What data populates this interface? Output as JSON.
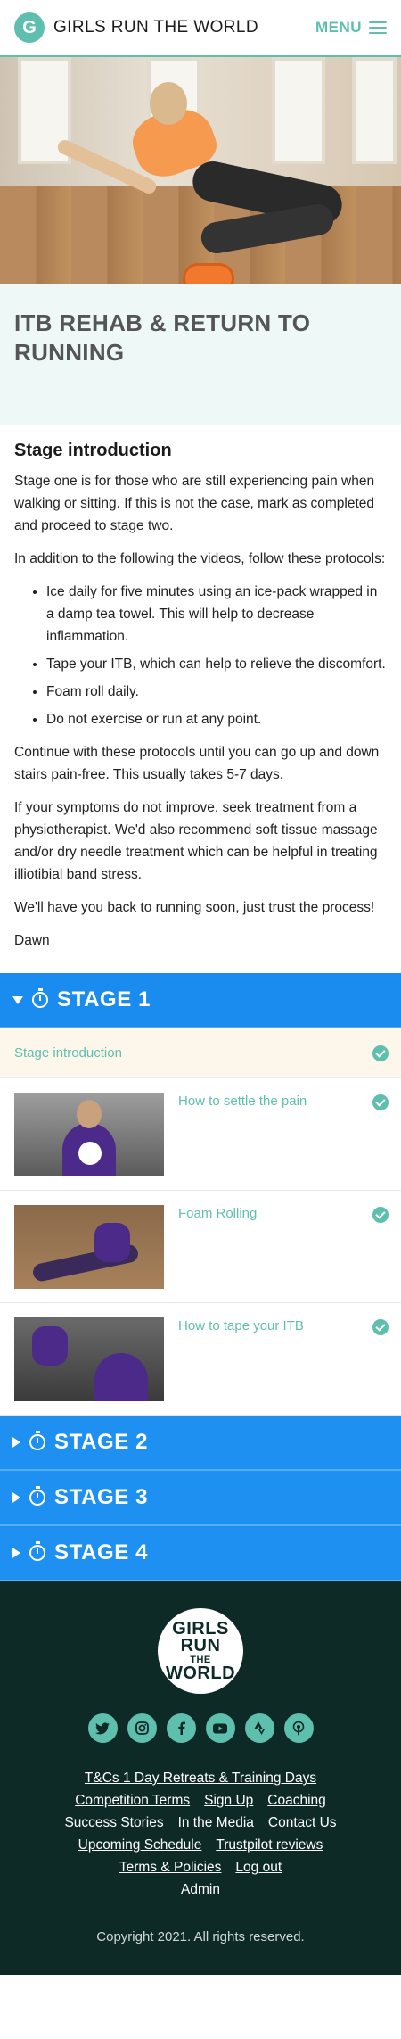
{
  "header": {
    "logo_letter": "G",
    "brand": "GIRLS RUN THE WORLD",
    "menu_label": "MENU"
  },
  "page": {
    "title": "ITB REHAB & RETURN TO RUNNING"
  },
  "intro": {
    "heading": "Stage introduction",
    "p1": "Stage one is for those who are still experiencing pain when walking or sitting. If this is not the case, mark as completed and proceed to stage two.",
    "p2": "In addition to the following the videos, follow these protocols:",
    "bullets": [
      "Ice daily for five minutes using an ice-pack wrapped in a damp tea towel. This will help to decrease inflammation.",
      "Tape your ITB, which can help to relieve the discomfort.",
      "Foam roll daily.",
      "Do not exercise or run at any point."
    ],
    "p3": "Continue with these protocols until you can go up and down stairs pain-free. This usually takes 5-7 days.",
    "p4": "If your symptoms do not improve, seek treatment from a physiotherapist. We'd also recommend soft tissue massage and/or dry needle treatment which can be helpful in treating illiotibial band stress.",
    "p5": "We'll have you back to running soon, just trust the process!",
    "signature": "Dawn"
  },
  "stages": [
    {
      "title": "STAGE 1",
      "expanded": true
    },
    {
      "title": "STAGE 2",
      "expanded": false
    },
    {
      "title": "STAGE 3",
      "expanded": false
    },
    {
      "title": "STAGE 4",
      "expanded": false
    }
  ],
  "stage1": {
    "intro_label": "Stage introduction",
    "lessons": [
      {
        "title": "How to settle the pain",
        "completed": true
      },
      {
        "title": "Foam Rolling",
        "completed": true
      },
      {
        "title": "How to tape your ITB",
        "completed": true
      }
    ]
  },
  "footer": {
    "logo_lines": [
      "GIRLS",
      "RUN",
      "THE",
      "WORLD"
    ],
    "socials": [
      "twitter-icon",
      "instagram-icon",
      "facebook-icon",
      "youtube-icon",
      "strava-icon",
      "podcast-icon"
    ],
    "links": {
      "tcs_retreats": "T&Cs 1 Day Retreats & Training Days",
      "competition_terms": "Competition Terms",
      "sign_up": "Sign Up",
      "coaching": "Coaching",
      "success_stories": "Success Stories",
      "in_the_media": "In the Media",
      "contact_us": "Contact Us",
      "upcoming_schedule": "Upcoming Schedule",
      "trustpilot_reviews": "Trustpilot reviews",
      "terms_policies": "Terms & Policies",
      "log_out": "Log out",
      "admin": "Admin"
    },
    "copyright": "Copyright 2021. All rights reserved."
  },
  "colors": {
    "teal": "#5fbfae",
    "stage_blue": "#1e90f2",
    "footer_bg": "#0e2a27",
    "title_band_bg": "#eef8f6",
    "intro_row_bg": "#fdf6ea"
  }
}
